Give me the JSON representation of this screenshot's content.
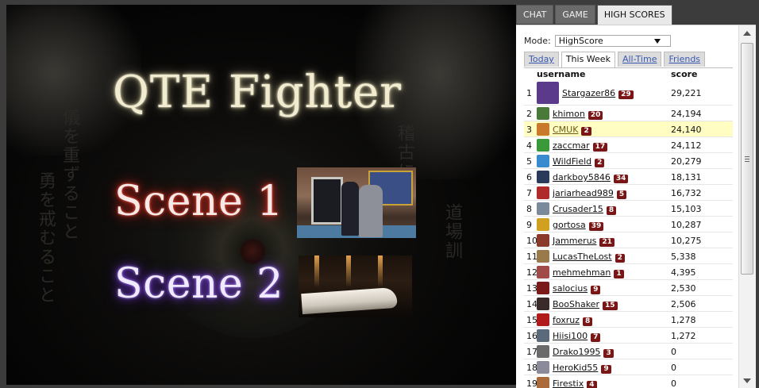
{
  "game": {
    "title": "QTE Fighter",
    "scene1_label": "Scene 1",
    "scene2_label": "Scene 2"
  },
  "panel": {
    "tabs": [
      {
        "label": "CHAT",
        "active": false
      },
      {
        "label": "GAME",
        "active": false
      },
      {
        "label": "HIGH SCORES",
        "active": true
      }
    ],
    "mode_label": "Mode:",
    "mode_value": "HighScore",
    "subtabs": [
      {
        "label": "Today",
        "active": false
      },
      {
        "label": "This Week",
        "active": true
      },
      {
        "label": "All-Time",
        "active": false
      },
      {
        "label": "Friends",
        "active": false
      }
    ],
    "columns": {
      "username": "username",
      "score": "score"
    },
    "rows": [
      {
        "rank": "1",
        "username": "Stargazer86",
        "level": "29",
        "score": "29,221",
        "avatar": "#5b3a8c"
      },
      {
        "rank": "2",
        "username": "khimon",
        "level": "20",
        "score": "24,194",
        "avatar": "#4a7a3a"
      },
      {
        "rank": "3",
        "username": "CMUK",
        "level": "2",
        "score": "24,140",
        "avatar": "#c87a2a"
      },
      {
        "rank": "4",
        "username": "zaccmar",
        "level": "17",
        "score": "24,112",
        "avatar": "#3a9a3a"
      },
      {
        "rank": "5",
        "username": "WildField",
        "level": "2",
        "score": "20,279",
        "avatar": "#3a8ad0"
      },
      {
        "rank": "6",
        "username": "darkboy5846",
        "level": "34",
        "score": "18,131",
        "avatar": "#2a3a5a"
      },
      {
        "rank": "7",
        "username": "jariarhead989",
        "level": "5",
        "score": "16,732",
        "avatar": "#b02a2a"
      },
      {
        "rank": "8",
        "username": "Crusader15",
        "level": "8",
        "score": "15,103",
        "avatar": "#7a8a9a"
      },
      {
        "rank": "9",
        "username": "gortosa",
        "level": "39",
        "score": "10,287",
        "avatar": "#d0a020"
      },
      {
        "rank": "10",
        "username": "Jammerus",
        "level": "21",
        "score": "10,275",
        "avatar": "#8a3a2a"
      },
      {
        "rank": "11",
        "username": "LucasTheLost",
        "level": "2",
        "score": "5,338",
        "avatar": "#9a7a4a"
      },
      {
        "rank": "12",
        "username": "mehmehman",
        "level": "1",
        "score": "4,395",
        "avatar": "#a04a4a"
      },
      {
        "rank": "13",
        "username": "salocius",
        "level": "9",
        "score": "2,530",
        "avatar": "#7a1a1a"
      },
      {
        "rank": "14",
        "username": "BooShaker",
        "level": "15",
        "score": "2,506",
        "avatar": "#3a2a2a"
      },
      {
        "rank": "15",
        "username": "foxruz",
        "level": "8",
        "score": "1,278",
        "avatar": "#b01a1a"
      },
      {
        "rank": "16",
        "username": "Hiisi100",
        "level": "7",
        "score": "1,272",
        "avatar": "#5a6a7a"
      },
      {
        "rank": "17",
        "username": "Drako1995",
        "level": "3",
        "score": "0",
        "avatar": "#6a6a6a"
      },
      {
        "rank": "18",
        "username": "HeroKid55",
        "level": "9",
        "score": "0",
        "avatar": "#8a8a9a"
      },
      {
        "rank": "19",
        "username": "Firestix",
        "level": "4",
        "score": "0",
        "avatar": "#aa6a3a"
      }
    ],
    "highlight_rank": "3"
  }
}
